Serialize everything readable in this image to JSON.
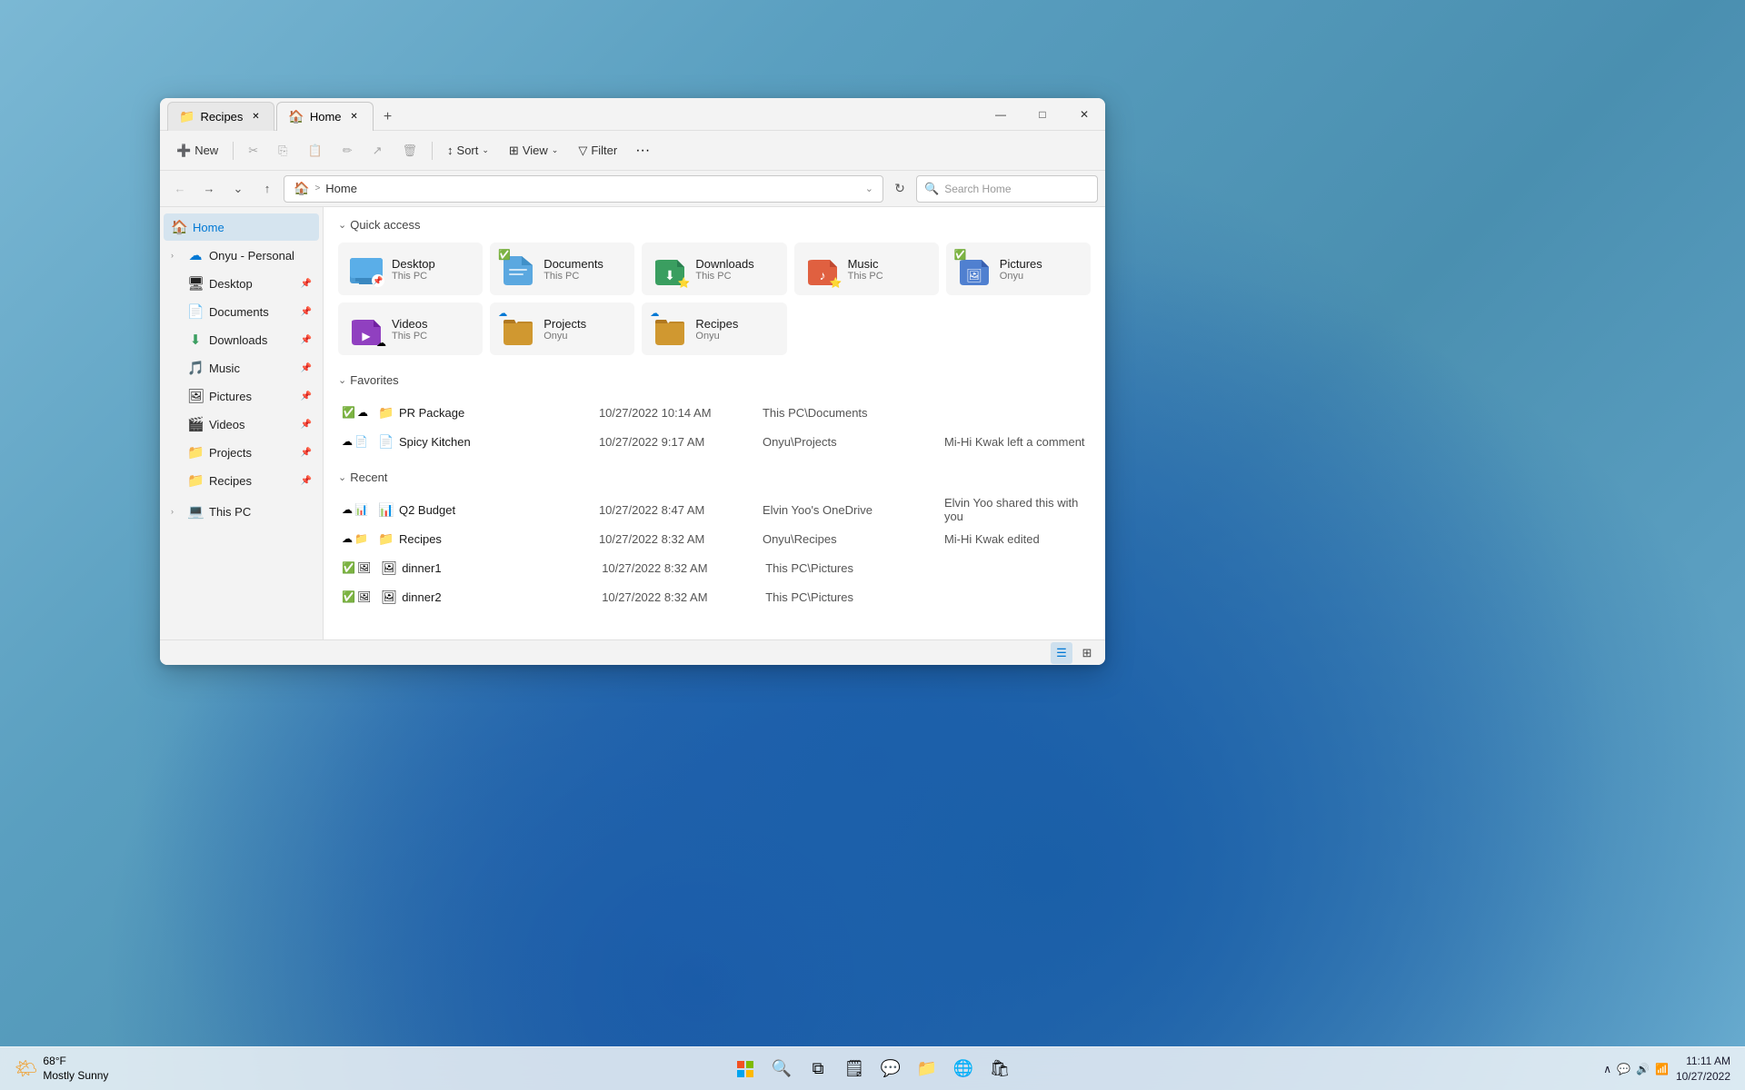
{
  "desktop": {
    "wallpaper_color": "#5a9fc0"
  },
  "window": {
    "title": "Home",
    "tabs": [
      {
        "id": "recipes",
        "label": "Recipes",
        "icon": "📁",
        "active": false
      },
      {
        "id": "home",
        "label": "Home",
        "icon": "🏠",
        "active": true
      }
    ],
    "add_tab_label": "+",
    "controls": {
      "minimize": "—",
      "maximize": "□",
      "close": "✕"
    }
  },
  "toolbar": {
    "new_label": "New",
    "cut_icon": "✂",
    "copy_icon": "⎘",
    "paste_icon": "📋",
    "rename_icon": "✏",
    "share_icon": "↗",
    "delete_icon": "🗑",
    "sort_label": "Sort",
    "view_label": "View",
    "filter_label": "Filter",
    "more_icon": "•••"
  },
  "addressbar": {
    "back_icon": "←",
    "forward_icon": "→",
    "dropdown_icon": "⌄",
    "up_icon": "↑",
    "home_icon": "🏠",
    "path_separator": ">",
    "path": "Home",
    "refresh_icon": "↻",
    "search_placeholder": "Search Home"
  },
  "sidebar": {
    "home_label": "Home",
    "onyu_label": "Onyu - Personal",
    "items": [
      {
        "id": "desktop",
        "label": "Desktop",
        "icon": "🖥",
        "pinned": true
      },
      {
        "id": "documents",
        "label": "Documents",
        "icon": "📄",
        "pinned": true
      },
      {
        "id": "downloads",
        "label": "Downloads",
        "icon": "⬇",
        "pinned": true
      },
      {
        "id": "music",
        "label": "Music",
        "icon": "🎵",
        "pinned": true
      },
      {
        "id": "pictures",
        "label": "Pictures",
        "icon": "🖼",
        "pinned": true
      },
      {
        "id": "videos",
        "label": "Videos",
        "icon": "🎬",
        "pinned": true
      },
      {
        "id": "projects",
        "label": "Projects",
        "icon": "📁",
        "pinned": true
      },
      {
        "id": "recipes",
        "label": "Recipes",
        "icon": "📁",
        "pinned": true
      }
    ],
    "this_pc_label": "This PC"
  },
  "main": {
    "quick_access_label": "Quick access",
    "favorites_label": "Favorites",
    "recent_label": "Recent",
    "folders": [
      {
        "id": "desktop",
        "name": "Desktop",
        "sub": "This PC",
        "icon": "🖥",
        "color": "#4a9bd4",
        "pin": true
      },
      {
        "id": "documents",
        "name": "Documents",
        "sub": "This PC",
        "icon": "📄",
        "color": "#5ba8e0",
        "cloud": true,
        "pin": true
      },
      {
        "id": "downloads",
        "name": "Downloads",
        "sub": "This PC",
        "icon": "⬇",
        "color": "#3a9e60",
        "pin": true
      },
      {
        "id": "music",
        "name": "Music",
        "sub": "This PC",
        "icon": "🎵",
        "color": "#e06040",
        "pin": true
      },
      {
        "id": "pictures",
        "name": "Pictures",
        "sub": "Onyu",
        "icon": "🖼",
        "color": "#5080d0",
        "cloud": true,
        "pin": true
      },
      {
        "id": "videos",
        "name": "Videos",
        "sub": "This PC",
        "icon": "🎬",
        "color": "#9040c0",
        "pin": true
      },
      {
        "id": "projects",
        "name": "Projects",
        "sub": "Onyu",
        "icon": "📁",
        "color": "#d09830",
        "cloud": true,
        "pin": true
      },
      {
        "id": "recipes",
        "name": "Recipes",
        "sub": "Onyu",
        "icon": "📁",
        "color": "#d09830",
        "cloud": true,
        "pin": true
      }
    ],
    "favorites": [
      {
        "id": "pr-package",
        "name": "PR Package",
        "date": "10/27/2022 10:14 AM",
        "location": "This PC\\Documents",
        "activity": "",
        "badges": [
          "✅",
          "☁"
        ]
      },
      {
        "id": "spicy-kitchen",
        "name": "Spicy Kitchen",
        "date": "10/27/2022 9:17 AM",
        "location": "Onyu\\Projects",
        "activity": "Mi-Hi Kwak left a comment",
        "badges": [
          "☁",
          "📄"
        ]
      }
    ],
    "recent": [
      {
        "id": "q2-budget",
        "name": "Q2 Budget",
        "date": "10/27/2022 8:47 AM",
        "location": "Elvin Yoo's OneDrive",
        "activity": "Elvin Yoo shared this with you",
        "badges": [
          "☁",
          "📊"
        ]
      },
      {
        "id": "recipes",
        "name": "Recipes",
        "date": "10/27/2022 8:32 AM",
        "location": "Onyu\\Recipes",
        "activity": "Mi-Hi Kwak edited",
        "badges": [
          "☁",
          "📁"
        ]
      },
      {
        "id": "dinner1",
        "name": "dinner1",
        "date": "10/27/2022 8:32 AM",
        "location": "This PC\\Pictures",
        "activity": "",
        "badges": [
          "✅",
          "🖼"
        ]
      },
      {
        "id": "dinner2",
        "name": "dinner2",
        "date": "10/27/2022 8:32 AM",
        "location": "This PC\\Pictures",
        "activity": "",
        "badges": [
          "✅",
          "🖼"
        ]
      }
    ]
  },
  "taskbar": {
    "weather_icon": "🌤",
    "temp": "68°F",
    "weather_desc": "Mostly Sunny",
    "start_icon": "⊞",
    "search_icon": "🔍",
    "taskview_icon": "⧉",
    "chat_icon": "💬",
    "explorer_icon": "📁",
    "edge_icon": "🌐",
    "store_icon": "🛍",
    "time": "11:11 AM",
    "date": "10/27/2022",
    "sys_icons": [
      "∧",
      "💬",
      "🔊",
      "📶"
    ]
  },
  "bottombar": {
    "list_view_icon": "≡",
    "grid_view_icon": "⊞"
  }
}
